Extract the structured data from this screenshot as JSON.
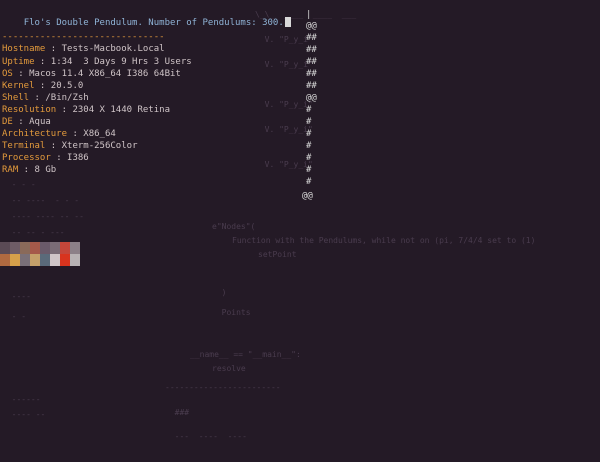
{
  "title": "Flo's Double Pendulum. Number of Pendulums: 300.",
  "separator": "------------------------------",
  "info": [
    {
      "key": "Hostname",
      "value": "Tests-Macbook.Local"
    },
    {
      "key": "Uptime",
      "value": "1:34  3 Days 9 Hrs 3 Users"
    },
    {
      "key": "OS",
      "value": "Macos 11.4 X86_64 I386 64Bit"
    },
    {
      "key": "Kernel",
      "value": "20.5.0"
    },
    {
      "key": "Shell",
      "value": "/Bin/Zsh"
    },
    {
      "key": "Resolution",
      "value": "2304 X 1440 Retina"
    },
    {
      "key": "DE",
      "value": "Aqua"
    },
    {
      "key": "Architecture",
      "value": "X86_64"
    },
    {
      "key": "Terminal",
      "value": "Xterm-256Color"
    },
    {
      "key": "Processor",
      "value": "I386"
    },
    {
      "key": "RAM",
      "value": "8 Gb"
    }
  ],
  "pendulum": {
    "top_glyph": "|",
    "top_ring": "@@",
    "arm": "##",
    "joint": "@@",
    "string": "#",
    "bob": "@@"
  },
  "ghost_code": [
    "e\"Nodes\"(",
    "Function with the Pendulums, while not on (pi, 7/4/4 set to (1)",
    "setPoint",
    "__name__ == \"__main__\":",
    "resolve"
  ],
  "colors": {
    "background": "#241a26",
    "accent": "#e39a3c",
    "title": "#8fb3d6",
    "text": "#cfc4c7"
  },
  "swatches_row1": [
    "#5a4a55",
    "#6e5c66",
    "#8a6a5a",
    "#a5594a",
    "#6a5a6a",
    "#7a6c76",
    "#c4463a",
    "#8c8088"
  ],
  "swatches_row2": [
    "#b06a40",
    "#d6a04a",
    "#7a7078",
    "#c4a06a",
    "#5a6a7a",
    "#d0c6c8",
    "#d8341e",
    "#b8b2b4"
  ]
}
